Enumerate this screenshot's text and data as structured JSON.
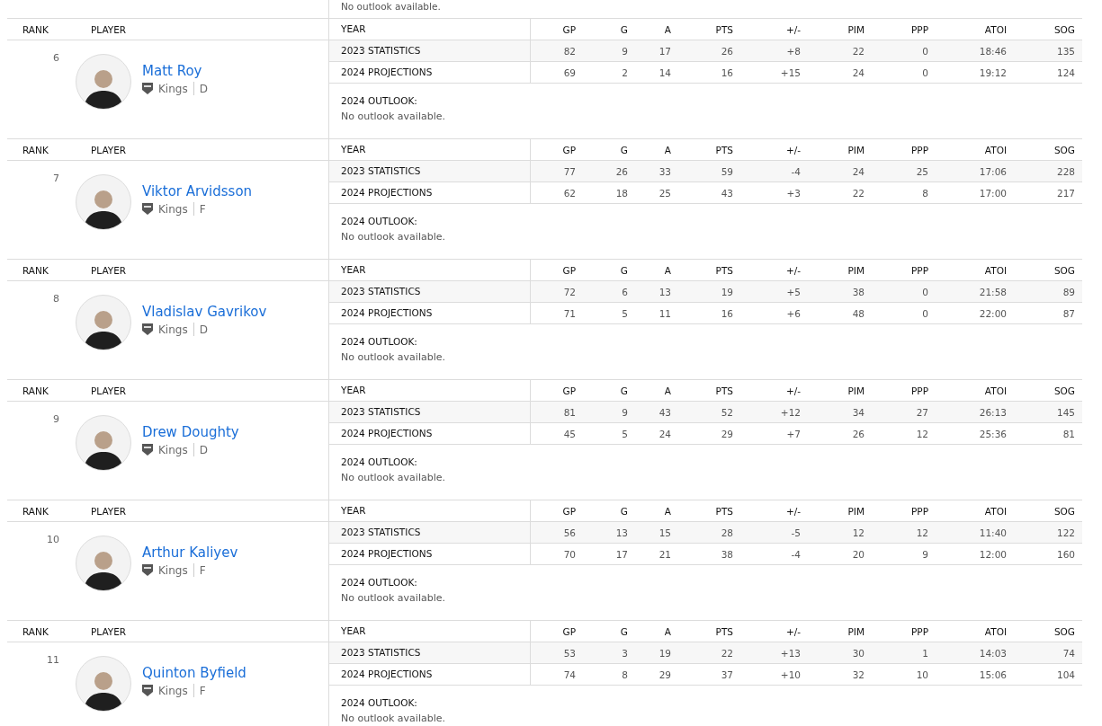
{
  "previous_outlook": {
    "text": "No outlook available."
  },
  "players": [
    {
      "rank_header": "RANK",
      "player_header": "PLAYER",
      "columns": [
        "YEAR",
        "GP",
        "G",
        "A",
        "PTS",
        "+/-",
        "PIM",
        "PPP",
        "ATOI",
        "SOG"
      ],
      "rank": "6",
      "name": "Matt Roy",
      "team": "Kings",
      "position": "D",
      "rows": [
        [
          "2023 STATISTICS",
          "82",
          "9",
          "17",
          "26",
          "+8",
          "22",
          "0",
          "18:46",
          "135"
        ],
        [
          "2024 PROJECTIONS",
          "69",
          "2",
          "14",
          "16",
          "+15",
          "24",
          "0",
          "19:12",
          "124"
        ]
      ],
      "outlook_label": "2024 OUTLOOK:",
      "outlook": "No outlook available."
    },
    {
      "rank_header": "RANK",
      "player_header": "PLAYER",
      "columns": [
        "YEAR",
        "GP",
        "G",
        "A",
        "PTS",
        "+/-",
        "PIM",
        "PPP",
        "ATOI",
        "SOG"
      ],
      "rank": "7",
      "name": "Viktor Arvidsson",
      "team": "Kings",
      "position": "F",
      "rows": [
        [
          "2023 STATISTICS",
          "77",
          "26",
          "33",
          "59",
          "-4",
          "24",
          "25",
          "17:06",
          "228"
        ],
        [
          "2024 PROJECTIONS",
          "62",
          "18",
          "25",
          "43",
          "+3",
          "22",
          "8",
          "17:00",
          "217"
        ]
      ],
      "outlook_label": "2024 OUTLOOK:",
      "outlook": "No outlook available."
    },
    {
      "rank_header": "RANK",
      "player_header": "PLAYER",
      "columns": [
        "YEAR",
        "GP",
        "G",
        "A",
        "PTS",
        "+/-",
        "PIM",
        "PPP",
        "ATOI",
        "SOG"
      ],
      "rank": "8",
      "name": "Vladislav Gavrikov",
      "team": "Kings",
      "position": "D",
      "rows": [
        [
          "2023 STATISTICS",
          "72",
          "6",
          "13",
          "19",
          "+5",
          "38",
          "0",
          "21:58",
          "89"
        ],
        [
          "2024 PROJECTIONS",
          "71",
          "5",
          "11",
          "16",
          "+6",
          "48",
          "0",
          "22:00",
          "87"
        ]
      ],
      "outlook_label": "2024 OUTLOOK:",
      "outlook": "No outlook available."
    },
    {
      "rank_header": "RANK",
      "player_header": "PLAYER",
      "columns": [
        "YEAR",
        "GP",
        "G",
        "A",
        "PTS",
        "+/-",
        "PIM",
        "PPP",
        "ATOI",
        "SOG"
      ],
      "rank": "9",
      "name": "Drew Doughty",
      "team": "Kings",
      "position": "D",
      "rows": [
        [
          "2023 STATISTICS",
          "81",
          "9",
          "43",
          "52",
          "+12",
          "34",
          "27",
          "26:13",
          "145"
        ],
        [
          "2024 PROJECTIONS",
          "45",
          "5",
          "24",
          "29",
          "+7",
          "26",
          "12",
          "25:36",
          "81"
        ]
      ],
      "outlook_label": "2024 OUTLOOK:",
      "outlook": "No outlook available."
    },
    {
      "rank_header": "RANK",
      "player_header": "PLAYER",
      "columns": [
        "YEAR",
        "GP",
        "G",
        "A",
        "PTS",
        "+/-",
        "PIM",
        "PPP",
        "ATOI",
        "SOG"
      ],
      "rank": "10",
      "name": "Arthur Kaliyev",
      "team": "Kings",
      "position": "F",
      "rows": [
        [
          "2023 STATISTICS",
          "56",
          "13",
          "15",
          "28",
          "-5",
          "12",
          "12",
          "11:40",
          "122"
        ],
        [
          "2024 PROJECTIONS",
          "70",
          "17",
          "21",
          "38",
          "-4",
          "20",
          "9",
          "12:00",
          "160"
        ]
      ],
      "outlook_label": "2024 OUTLOOK:",
      "outlook": "No outlook available."
    },
    {
      "rank_header": "RANK",
      "player_header": "PLAYER",
      "columns": [
        "YEAR",
        "GP",
        "G",
        "A",
        "PTS",
        "+/-",
        "PIM",
        "PPP",
        "ATOI",
        "SOG"
      ],
      "rank": "11",
      "name": "Quinton Byfield",
      "team": "Kings",
      "position": "F",
      "rows": [
        [
          "2023 STATISTICS",
          "53",
          "3",
          "19",
          "22",
          "+13",
          "30",
          "1",
          "14:03",
          "74"
        ],
        [
          "2024 PROJECTIONS",
          "74",
          "8",
          "29",
          "37",
          "+10",
          "32",
          "10",
          "15:06",
          "104"
        ]
      ],
      "outlook_label": "2024 OUTLOOK:",
      "outlook": "No outlook available."
    }
  ]
}
